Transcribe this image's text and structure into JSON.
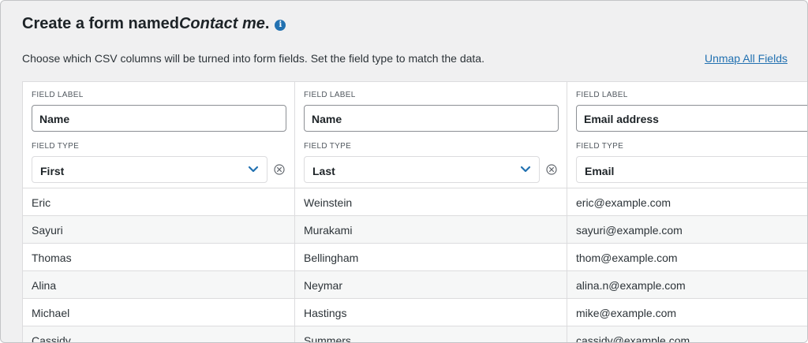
{
  "header": {
    "title_prefix": "Create a form named ",
    "form_name": "Contact me",
    "title_suffix": ".",
    "info_icon_glyph": "i",
    "description": "Choose which CSV columns will be turned into form fields. Set the field type to match the data.",
    "unmap_label": "Unmap All Fields"
  },
  "columns": [
    {
      "field_label_heading": "FIELD LABEL",
      "field_label_value": "Name",
      "field_type_heading": "FIELD TYPE",
      "field_type_value": "First",
      "rows": [
        "Eric",
        "Sayuri",
        "Thomas",
        "Alina",
        "Michael",
        "Cassidy"
      ]
    },
    {
      "field_label_heading": "FIELD LABEL",
      "field_label_value": "Name",
      "field_type_heading": "FIELD TYPE",
      "field_type_value": "Last",
      "rows": [
        "Weinstein",
        "Murakami",
        "Bellingham",
        "Neymar",
        "Hastings",
        "Summers"
      ]
    },
    {
      "field_label_heading": "FIELD LABEL",
      "field_label_value": "Email address",
      "field_type_heading": "FIELD TYPE",
      "field_type_value": "Email",
      "rows": [
        "eric@example.com",
        "sayuri@example.com",
        "thom@example.com",
        "alina.n@example.com",
        "mike@example.com",
        "cassidy@example.com"
      ]
    }
  ],
  "icons": {
    "info": "info-icon",
    "chevron": "chevron-down-icon",
    "clear": "clear-circle-icon"
  },
  "colors": {
    "accent": "#2271b1",
    "page_background": "#f0f0f1",
    "table_background": "#ffffff",
    "alt_row": "#f6f7f7",
    "border": "#dcdcde"
  }
}
